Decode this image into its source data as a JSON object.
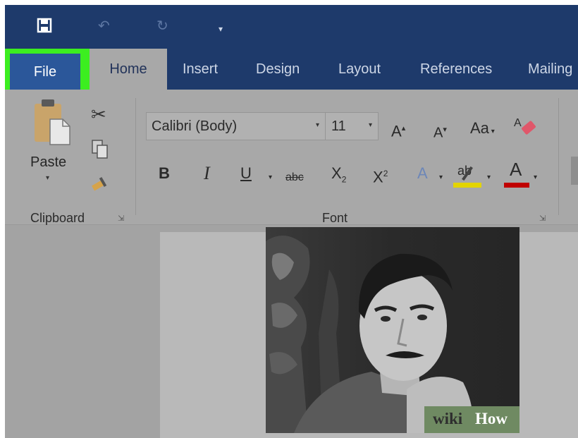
{
  "quick_access": {
    "save_icon": "save-icon",
    "undo_icon": "undo-icon",
    "redo_icon": "redo-icon",
    "customize_icon": "customize-icon"
  },
  "tabs": [
    {
      "id": "file",
      "label": "File",
      "highlighted": true
    },
    {
      "id": "home",
      "label": "Home",
      "active": true
    },
    {
      "id": "insert",
      "label": "Insert"
    },
    {
      "id": "design",
      "label": "Design"
    },
    {
      "id": "layout",
      "label": "Layout"
    },
    {
      "id": "references",
      "label": "References"
    },
    {
      "id": "mailings",
      "label": "Mailing"
    }
  ],
  "ribbon": {
    "clipboard": {
      "paste_label": "Paste",
      "group_label": "Clipboard"
    },
    "font": {
      "font_name": "Calibri (Body)",
      "font_size": "11",
      "group_label": "Font",
      "grow_label": "A",
      "shrink_label": "A",
      "case_label": "Aa",
      "bold_label": "B",
      "italic_label": "I",
      "underline_label": "U",
      "strike_label": "abc",
      "sub_label": "X",
      "sub_mark": "2",
      "sup_label": "X",
      "sup_mark": "2",
      "effects_label": "A",
      "highlight_label": "ab",
      "fontcolor_label": "A"
    }
  },
  "watermark": {
    "part1": "wiki",
    "part2": "How"
  },
  "colors": {
    "titlebar": "#1e3a6b",
    "file_tab": "#2b579a",
    "highlight_box": "#3cee20",
    "highlight_color": "#e3d400",
    "font_color": "#c00000"
  }
}
